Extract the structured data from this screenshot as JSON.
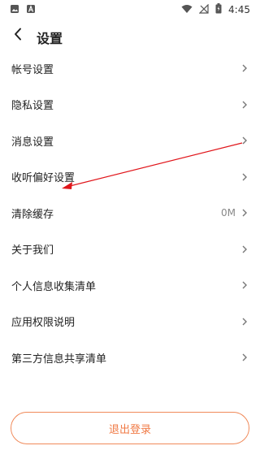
{
  "status_bar": {
    "time": "4:45",
    "left_icons": [
      "photo-icon",
      "a-app-icon"
    ],
    "right_icons": [
      "wifi-icon",
      "signal-off-icon",
      "battery-charging-icon"
    ]
  },
  "header": {
    "title": "设置",
    "back_icon": "chevron-left-icon"
  },
  "settings": {
    "items": [
      {
        "label": "帐号设置",
        "value": ""
      },
      {
        "label": "隐私设置",
        "value": ""
      },
      {
        "label": "消息设置",
        "value": ""
      },
      {
        "label": "收听偏好设置",
        "value": ""
      },
      {
        "label": "清除缓存",
        "value": "0M"
      },
      {
        "label": "关于我们",
        "value": ""
      },
      {
        "label": "个人信息收集清单",
        "value": ""
      },
      {
        "label": "应用权限说明",
        "value": ""
      },
      {
        "label": "第三方信息共享清单",
        "value": ""
      }
    ]
  },
  "logout": {
    "label": "退出登录"
  },
  "colors": {
    "accent": "#f07a45",
    "annotation_arrow": "#e0161b"
  }
}
